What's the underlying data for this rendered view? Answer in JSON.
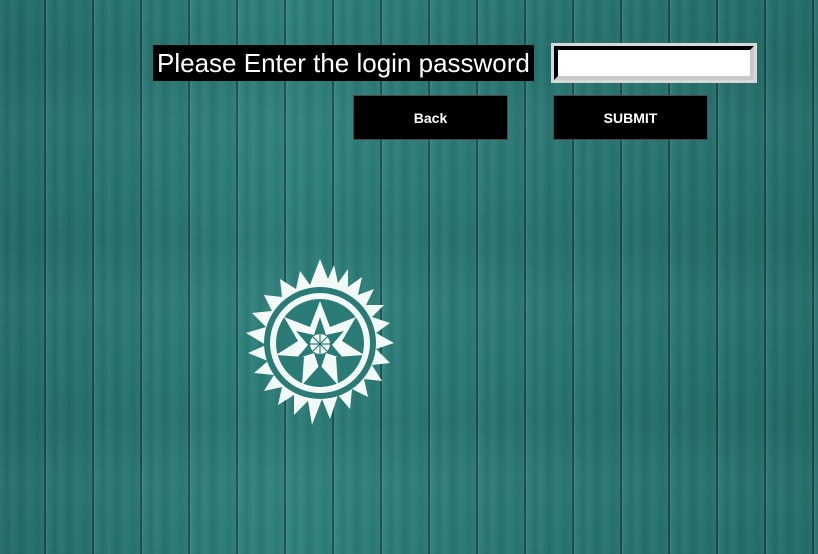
{
  "login": {
    "prompt": "Please Enter the login password",
    "password_value": "",
    "back_label": "Back",
    "submit_label": "SUBMIT"
  },
  "logo": {
    "icon": "sun-emblem-icon",
    "color": "#f2faf8"
  },
  "colors": {
    "background": "#2a7a76",
    "button_bg": "#000000",
    "button_text": "#ffffff"
  }
}
